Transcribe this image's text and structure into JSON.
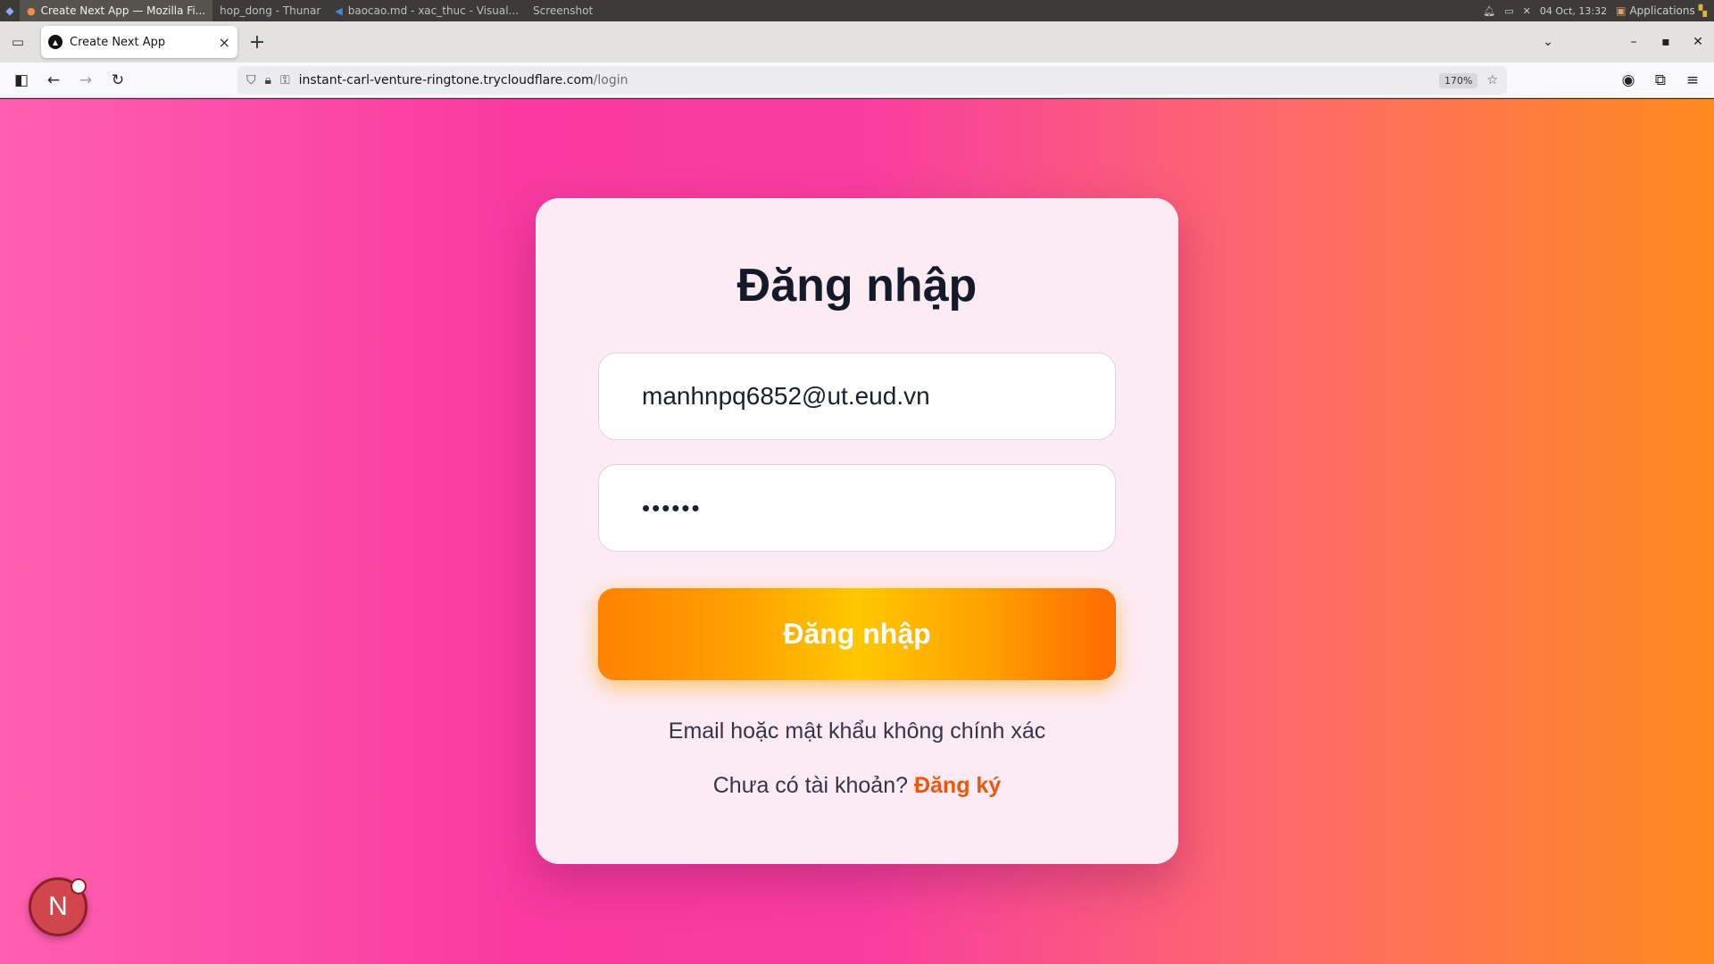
{
  "taskbar": {
    "tasks": [
      {
        "label": "Create Next App — Mozilla Fi...",
        "icon": "firefox-icon",
        "active": true
      },
      {
        "label": "hop_dong - Thunar",
        "icon": "",
        "active": false
      },
      {
        "label": "baocao.md - xac_thuc - Visual...",
        "icon": "vscode-icon",
        "active": false
      },
      {
        "label": "Screenshot",
        "icon": "",
        "active": false
      }
    ],
    "datetime": "04 Oct, 13:32",
    "applications_label": "Applications"
  },
  "browser": {
    "tab_title": "Create Next App",
    "url_host": "instant-carl-venture-ringtone.trycloudflare.com",
    "url_path": "/login",
    "zoom": "170%"
  },
  "login": {
    "title": "Đăng nhập",
    "email_value": "manhnpq6852@ut.eud.vn",
    "password_value": "••••••",
    "submit_label": "Đăng nhập",
    "error_message": "Email hoặc mật khẩu không chính xác",
    "register_prompt": "Chưa có tài khoản?",
    "register_link": "Đăng ký"
  },
  "next_badge": {
    "letter": "N"
  },
  "colors": {
    "card_bg": "#fdebf4",
    "title": "#151a2b",
    "button_gradient_start": "#ff8200",
    "button_gradient_mid": "#ffc800",
    "register_link": "#f0560a"
  }
}
